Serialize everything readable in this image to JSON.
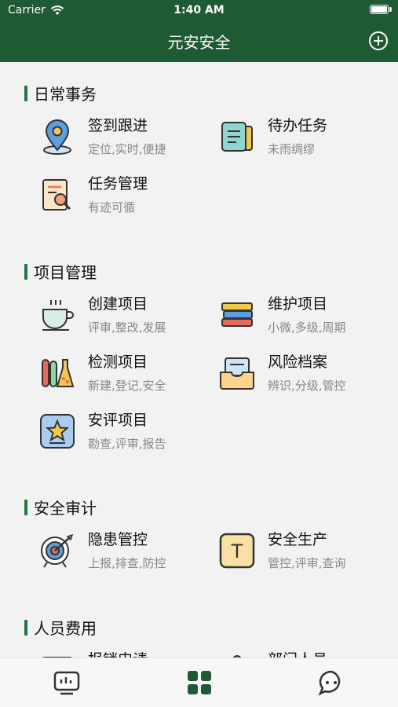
{
  "status": {
    "carrier": "Carrier",
    "time": "1:40 AM"
  },
  "nav": {
    "title": "元安安全"
  },
  "sections": [
    {
      "title": "日常事务",
      "items": [
        {
          "title": "签到跟进",
          "sub": "定位,实时,便捷",
          "icon": "location-pin-icon"
        },
        {
          "title": "待办任务",
          "sub": "未雨绸缪",
          "icon": "todo-list-icon"
        },
        {
          "title": "任务管理",
          "sub": "有迹可循",
          "icon": "document-search-icon"
        }
      ]
    },
    {
      "title": "项目管理",
      "items": [
        {
          "title": "创建项目",
          "sub": "评审,整改,发展",
          "icon": "teacup-icon"
        },
        {
          "title": "维护项目",
          "sub": "小微,多级,周期",
          "icon": "book-stack-icon"
        },
        {
          "title": "检测项目",
          "sub": "新建,登记,安全",
          "icon": "test-tube-icon"
        },
        {
          "title": "风险档案",
          "sub": "辨识,分级,管控",
          "icon": "inbox-tray-icon"
        },
        {
          "title": "安评项目",
          "sub": "勘查,评审,报告",
          "icon": "star-badge-icon"
        }
      ]
    },
    {
      "title": "安全审计",
      "items": [
        {
          "title": "隐患管控",
          "sub": "上报,排查,防控",
          "icon": "target-icon"
        },
        {
          "title": "安全生产",
          "sub": "管控,评审,查询",
          "icon": "letter-t-icon"
        }
      ]
    },
    {
      "title": "人员费用",
      "items": [
        {
          "title": "报销申请",
          "sub": "",
          "icon": "receipt-icon"
        },
        {
          "title": "部门人员",
          "sub": "",
          "icon": "person-icon"
        }
      ]
    }
  ],
  "tabs": [
    {
      "name": "dashboard",
      "icon": "monitor-icon"
    },
    {
      "name": "apps",
      "icon": "grid-icon"
    },
    {
      "name": "chat",
      "icon": "chat-icon"
    }
  ],
  "colors": {
    "header": "#1e5a33",
    "accent": "#1e7a40"
  }
}
